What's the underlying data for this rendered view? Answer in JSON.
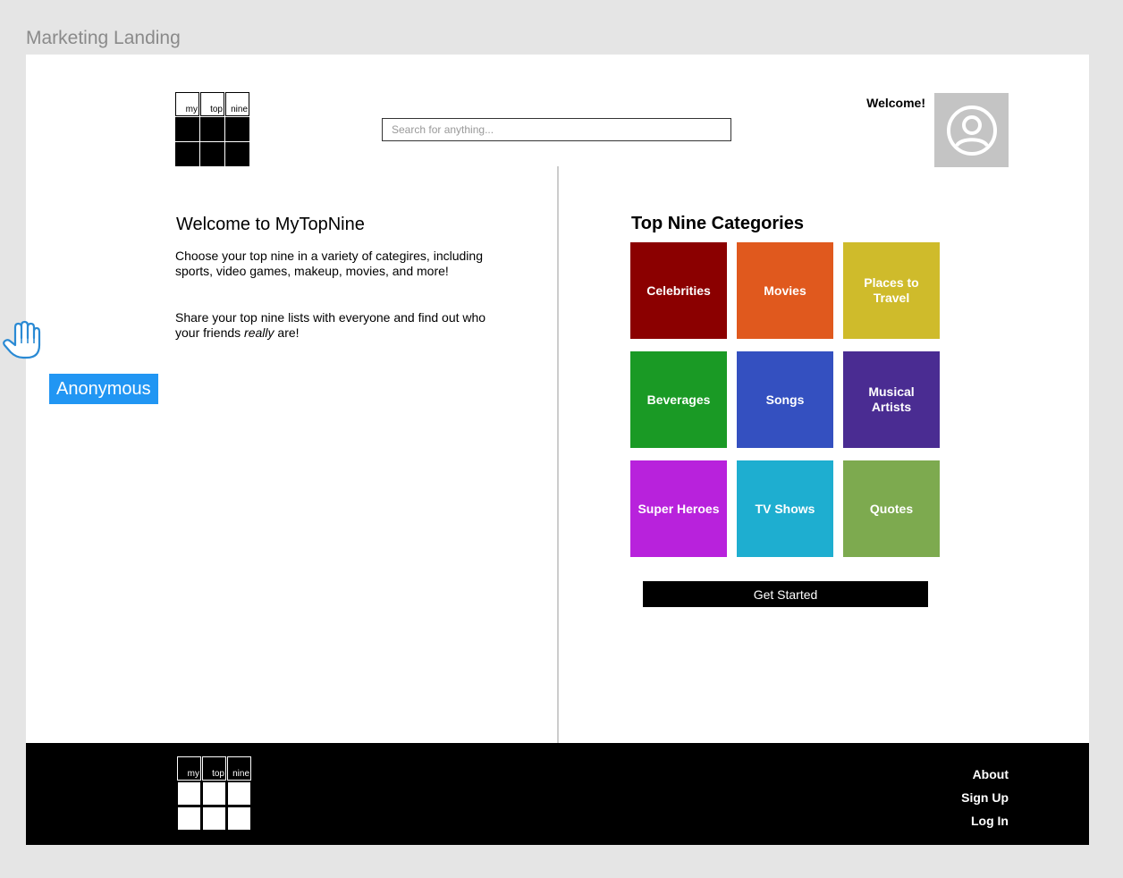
{
  "frame": {
    "title": "Marketing Landing"
  },
  "logo": {
    "labels": [
      "my",
      "top",
      "nine"
    ]
  },
  "header": {
    "search_placeholder": "Search for anything...",
    "welcome": "Welcome!",
    "avatar_icon": "user-circle-icon"
  },
  "intro": {
    "title": "Welcome to MyTopNine",
    "p1": "Choose your top nine in a variety of categires, including sports, video games, makeup, movies, and more!",
    "p2_before": "Share your top nine lists with everyone and find out who your friends ",
    "p2_em": "really",
    "p2_after": " are!"
  },
  "categories": {
    "title": "Top Nine Categories",
    "items": [
      {
        "label": "Celebrities",
        "color": "#8b0000"
      },
      {
        "label": "Movies",
        "color": "#e0591e"
      },
      {
        "label": "Places to Travel",
        "color": "#cfbb2b"
      },
      {
        "label": "Beverages",
        "color": "#1a9a25"
      },
      {
        "label": "Songs",
        "color": "#3450c0"
      },
      {
        "label": "Musical Artists",
        "color": "#4a2c92"
      },
      {
        "label": "Super Heroes",
        "color": "#b822dc"
      },
      {
        "label": "TV Shows",
        "color": "#1eaed0"
      },
      {
        "label": "Quotes",
        "color": "#7daa4f"
      }
    ],
    "cta": "Get Started"
  },
  "footer": {
    "links": [
      "About",
      "Sign Up",
      "Log In"
    ]
  },
  "overlay": {
    "cursor_icon": "hand-pointer-icon",
    "user_badge": "Anonymous",
    "badge_color": "#2196f3"
  }
}
